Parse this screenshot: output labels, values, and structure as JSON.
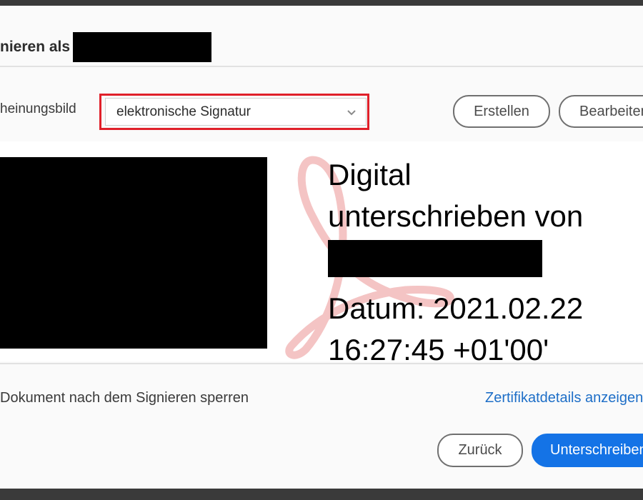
{
  "dialog": {
    "title": "nieren als"
  },
  "appearance": {
    "label": "heinungsbild",
    "selected": "elektronische Signatur",
    "create_label": "Erstellen",
    "edit_label": "Bearbeiten"
  },
  "preview": {
    "line1": "Digital",
    "line2": "unterschrieben von",
    "line3": "Datum: 2021.02.22",
    "line4": "16:27:45 +01'00'"
  },
  "footer": {
    "lock_text": "Dokument nach dem Signieren sperren",
    "cert_link": "Zertifikatdetails anzeigen",
    "back_label": "Zurück",
    "sign_label": "Unterschreiben"
  },
  "colors": {
    "highlight": "#e0202a",
    "primary": "#1473e6",
    "link": "#1d6ec7"
  }
}
